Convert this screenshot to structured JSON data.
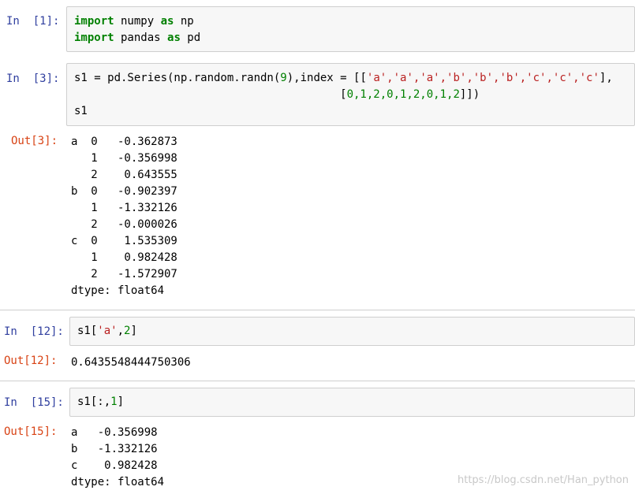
{
  "cells": [
    {
      "in_prompt": "In  [1]:",
      "code": {
        "l1_kw1": "import",
        "l1_mid": " numpy ",
        "l1_kw2": "as",
        "l1_end": " np",
        "l2_kw1": "import",
        "l2_mid": " pandas ",
        "l2_kw2": "as",
        "l2_end": " pd"
      }
    },
    {
      "in_prompt": "In  [3]:",
      "code": {
        "l1_a": "s1 = pd.Series(np.random.randn(",
        "l1_n9": "9",
        "l1_b": "),index = [[",
        "l1_strs": "'a','a','a','b','b','b','c','c','c'",
        "l1_c": "],",
        "l2_pad": "                                        [",
        "l2_nums": "0,1,2,0,1,2,0,1,2",
        "l2_end": "]])",
        "l3": "s1"
      },
      "out_prompt": "Out[3]:",
      "output": "a  0   -0.362873\n   1   -0.356998\n   2    0.643555\nb  0   -0.902397\n   1   -1.332126\n   2   -0.000026\nc  0    1.535309\n   1    0.982428\n   2   -1.572907\ndtype: float64"
    },
    {
      "in_prompt": "In  [12]:",
      "code": {
        "a": "s1[",
        "str": "'a'",
        "b": ",",
        "num": "2",
        "c": "]"
      },
      "out_prompt": "Out[12]:",
      "output": "0.6435548444750306"
    },
    {
      "in_prompt": "In  [15]:",
      "code": {
        "a": "s1[:,",
        "num": "1",
        "b": "]"
      },
      "out_prompt": "Out[15]:",
      "output": "a   -0.356998\nb   -1.332126\nc    0.982428\ndtype: float64"
    }
  ],
  "watermark": "https://blog.csdn.net/Han_python",
  "colors": {
    "in_prompt": "#303f9f",
    "out_prompt": "#d84315",
    "keyword": "#008000",
    "string": "#ba2121",
    "number": "#008000",
    "input_bg": "#f7f7f7"
  }
}
